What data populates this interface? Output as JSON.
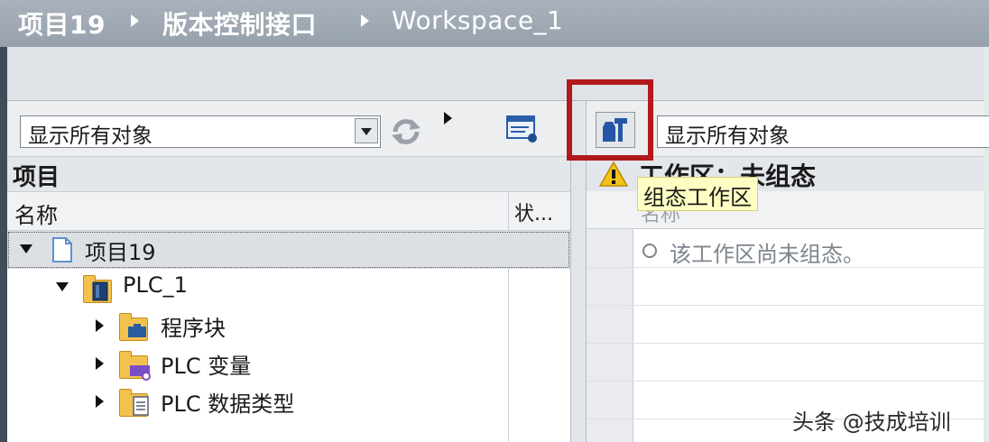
{
  "breadcrumb": {
    "project": "项目19",
    "interface": "版本控制接口",
    "workspace": "Workspace_1"
  },
  "left_panel": {
    "filter": {
      "value": "显示所有对象"
    },
    "section_title": "项目",
    "columns": {
      "name": "名称",
      "status": "状..."
    },
    "tree": [
      {
        "label": "项目19",
        "expanded": true
      },
      {
        "label": "PLC_1",
        "expanded": true
      },
      {
        "label": "程序块",
        "expanded": false
      },
      {
        "label": "PLC 变量",
        "expanded": false
      },
      {
        "label": "PLC 数据类型",
        "expanded": false
      }
    ]
  },
  "right_panel": {
    "filter": {
      "value": "显示所有对象"
    },
    "section_title": "工作区：未组态",
    "column_name": "名称",
    "message": "该工作区尚未组态。",
    "tooltip": "组态工作区"
  },
  "watermark": "头条 @技成培训",
  "colors": {
    "highlight": "#b1191b",
    "titlebar": "#a1aab4",
    "tooltip_bg": "#ffffc4"
  },
  "icons": [
    "refresh-icon",
    "expand-arrow-icon",
    "device-view-icon",
    "configure-workspace-icon",
    "warning-icon",
    "folder-icon"
  ]
}
